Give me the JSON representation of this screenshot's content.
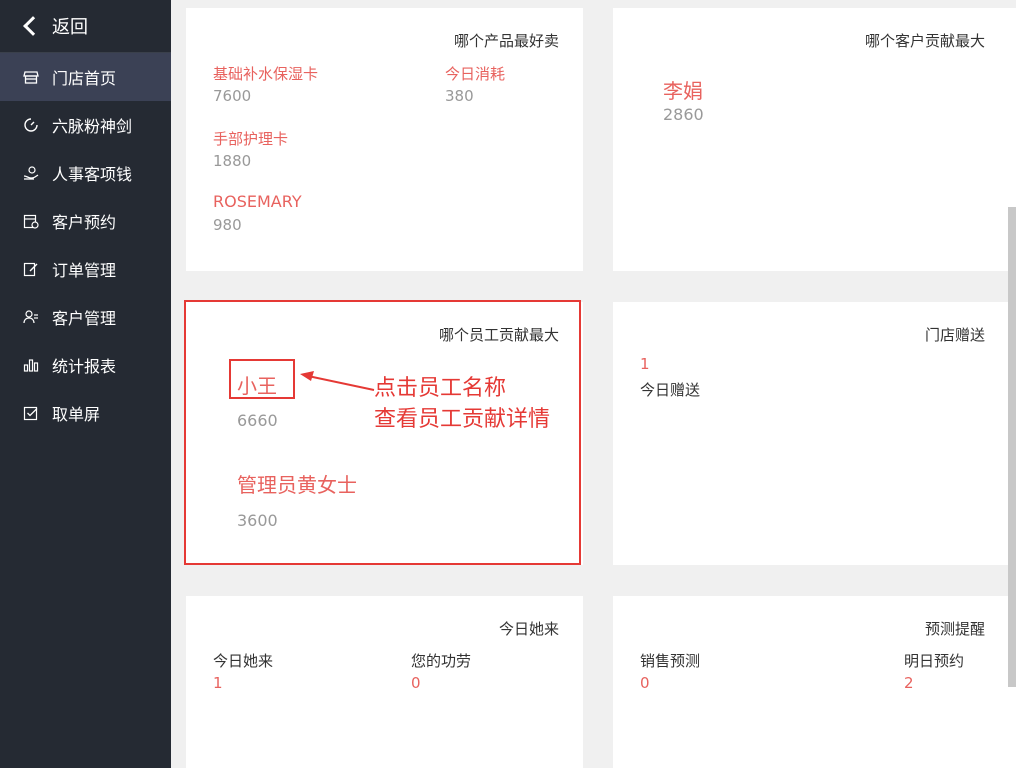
{
  "sidebar": {
    "back_label": "返回",
    "items": [
      {
        "label": "门店首页",
        "icon": "store-icon"
      },
      {
        "label": "六脉粉神剑",
        "icon": "timer-icon"
      },
      {
        "label": "人事客项钱",
        "icon": "finance-icon"
      },
      {
        "label": "客户预约",
        "icon": "calendar-icon"
      },
      {
        "label": "订单管理",
        "icon": "edit-icon"
      },
      {
        "label": "客户管理",
        "icon": "users-icon"
      },
      {
        "label": "统计报表",
        "icon": "chart-icon"
      },
      {
        "label": "取单屏",
        "icon": "checkbox-icon"
      }
    ]
  },
  "cards": {
    "products": {
      "title": "哪个产品最好卖",
      "items": [
        {
          "name": "基础补水保湿卡",
          "value": "7600"
        },
        {
          "name": "今日消耗",
          "value": "380"
        },
        {
          "name": "手部护理卡",
          "value": "1880"
        },
        {
          "name": "ROSEMARY",
          "value": "980"
        }
      ]
    },
    "customer": {
      "title": "哪个客户贡献最大",
      "name": "李娟",
      "value": "2860"
    },
    "employee": {
      "title": "哪个员工贡献最大",
      "items": [
        {
          "name": "小王",
          "value": "6660"
        },
        {
          "name": "管理员黄女士",
          "value": "3600"
        }
      ]
    },
    "gift": {
      "title": "门店赠送",
      "value": "1",
      "label": "今日赠送"
    },
    "today": {
      "title": "今日她来",
      "items": [
        {
          "label": "今日她来",
          "value": "1"
        },
        {
          "label": "您的功劳",
          "value": "0"
        }
      ]
    },
    "forecast": {
      "title": "预测提醒",
      "items": [
        {
          "label": "销售预测",
          "value": "0"
        },
        {
          "label": "明日预约",
          "value": "2"
        }
      ]
    }
  },
  "annotation": {
    "line1": "点击员工名称",
    "line2": "查看员工贡献详情"
  },
  "colors": {
    "accent": "#e8625e",
    "annotation": "#e53935",
    "sidebar_bg": "#252a33",
    "sidebar_active": "#3b4155"
  }
}
